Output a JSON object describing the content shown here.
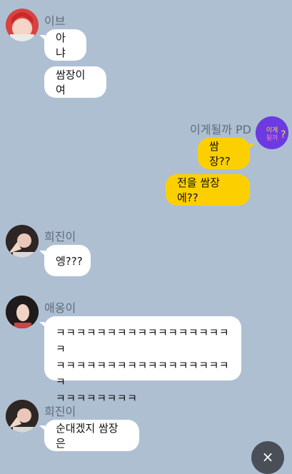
{
  "messages": [
    {
      "sender": "이브",
      "texts": [
        "아냐",
        "쌈장이여"
      ]
    },
    {
      "sender": "이게될까 PD",
      "texts": [
        "쌈장??",
        "전을 쌈장에??"
      ]
    },
    {
      "sender": "희진이",
      "texts": [
        "엥???"
      ]
    },
    {
      "sender": "애옹이",
      "texts": [
        "ㅋㅋㅋㅋㅋㅋㅋㅋㅋㅋㅋㅋㅋㅋㅋㅋㅋㅋ",
        "ㅋㅋㅋㅋㅋㅋㅋㅋㅋㅋㅋㅋㅋㅋㅋㅋㅋㅋ",
        "ㅋㅋㅋㅋㅋㅋㅋㅋ"
      ]
    },
    {
      "sender": "희진이",
      "texts": [
        "순대겠지 쌈장은"
      ]
    }
  ],
  "pd_avatar_label": "이게될까",
  "close_icon": "×",
  "colors": {
    "background": "#aebfd2",
    "my_bubble": "#fcd000",
    "their_bubble": "#ffffff"
  }
}
